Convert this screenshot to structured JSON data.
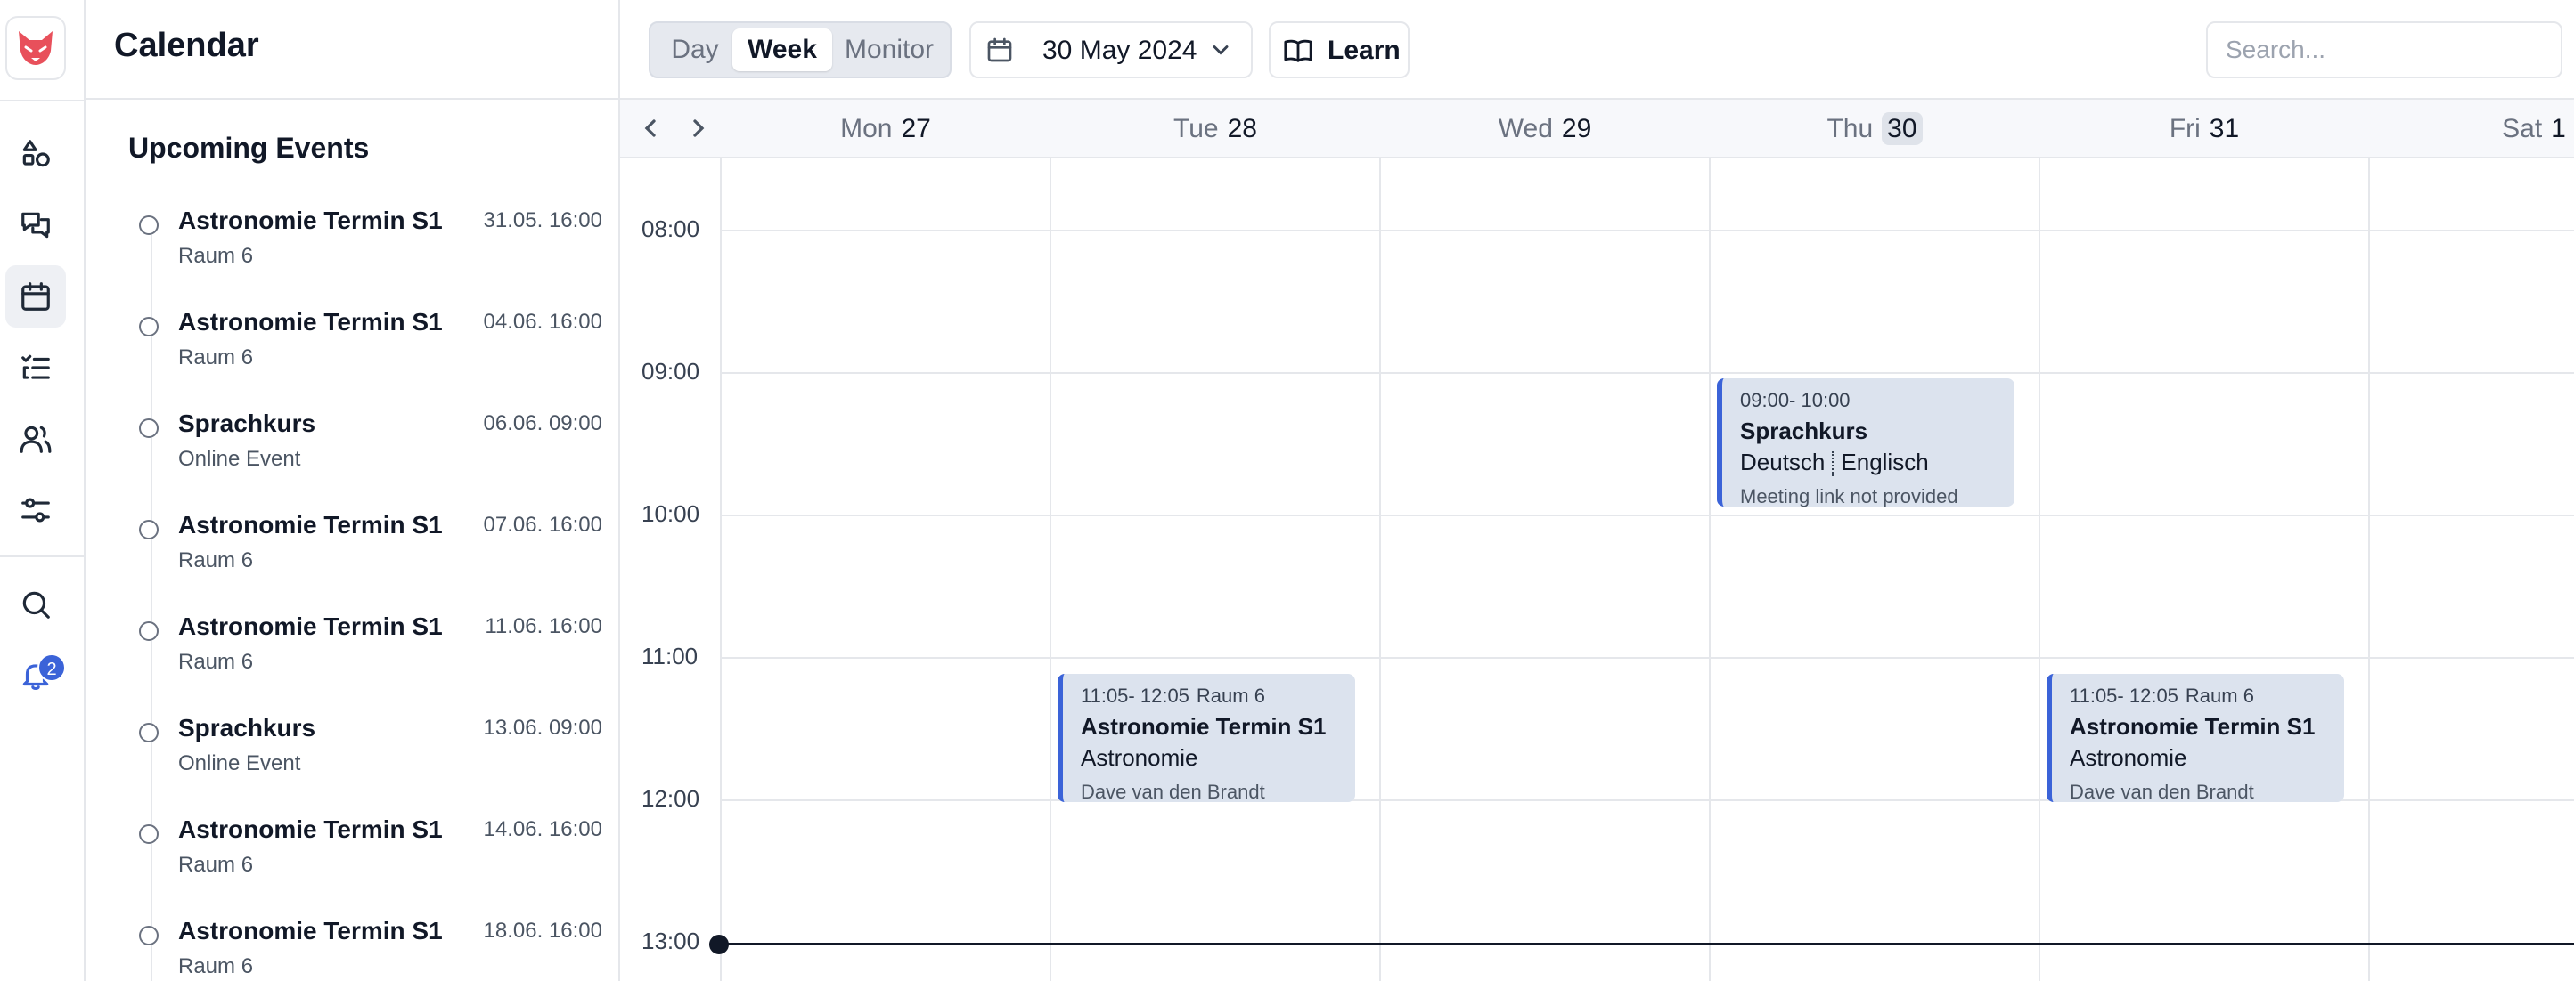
{
  "app": {
    "title": "Calendar"
  },
  "rail": {
    "items": [
      {
        "icon": "shapes-icon",
        "label": ""
      },
      {
        "icon": "chat-icon",
        "label": ""
      },
      {
        "icon": "calendar-icon",
        "label": "",
        "active": true
      },
      {
        "icon": "list-check-icon",
        "label": ""
      },
      {
        "icon": "users-icon",
        "label": ""
      },
      {
        "icon": "sliders-icon",
        "label": ""
      },
      {
        "icon": "search-icon",
        "label": ""
      },
      {
        "icon": "bell-icon",
        "label": ""
      }
    ],
    "notification_count": "2"
  },
  "sidebar": {
    "section_title": "Upcoming Events",
    "events": [
      {
        "title": "Astronomie Termin S1",
        "date": "31.05. 16:00",
        "location": "Raum 6"
      },
      {
        "title": "Astronomie Termin S1",
        "date": "04.06. 16:00",
        "location": "Raum 6"
      },
      {
        "title": "Sprachkurs",
        "date": "06.06. 09:00",
        "location": "Online Event"
      },
      {
        "title": "Astronomie Termin S1",
        "date": "07.06. 16:00",
        "location": "Raum 6"
      },
      {
        "title": "Astronomie Termin S1",
        "date": "11.06. 16:00",
        "location": "Raum 6"
      },
      {
        "title": "Sprachkurs",
        "date": "13.06. 09:00",
        "location": "Online Event"
      },
      {
        "title": "Astronomie Termin S1",
        "date": "14.06. 16:00",
        "location": "Raum 6"
      },
      {
        "title": "Astronomie Termin S1",
        "date": "18.06. 16:00",
        "location": "Raum 6"
      }
    ]
  },
  "toolbar": {
    "views": [
      "Day",
      "Week",
      "Monitor"
    ],
    "active_view": "Week",
    "date": "30 May 2024",
    "learn_label": "Learn",
    "search_placeholder": "Search..."
  },
  "calendar": {
    "days": [
      {
        "name": "Mon",
        "num": "27"
      },
      {
        "name": "Tue",
        "num": "28"
      },
      {
        "name": "Wed",
        "num": "29"
      },
      {
        "name": "Thu",
        "num": "30",
        "today": true
      },
      {
        "name": "Fri",
        "num": "31"
      },
      {
        "name": "Sat",
        "num": "1"
      }
    ],
    "hours": [
      "08:00",
      "09:00",
      "10:00",
      "11:00",
      "12:00",
      "13:00"
    ],
    "events": [
      {
        "day": "Thu",
        "time": "09:00- 10:00",
        "room": "",
        "title": "Sprachkurs",
        "subject_left": "Deutsch",
        "subject_right": "Englisch",
        "footer": "Meeting link not provided"
      },
      {
        "day": "Tue",
        "time": "11:05- 12:05",
        "room": "Raum 6",
        "title": "Astronomie Termin S1",
        "subject": "Astronomie",
        "footer": "Dave van den Brandt"
      },
      {
        "day": "Fri",
        "time": "11:05- 12:05",
        "room": "Raum 6",
        "title": "Astronomie Termin S1",
        "subject": "Astronomie",
        "footer": "Dave van den Brandt"
      }
    ]
  },
  "colors": {
    "accent": "#3b63d8",
    "event_bg": "#dce3ee",
    "logo": "#e8505b"
  }
}
